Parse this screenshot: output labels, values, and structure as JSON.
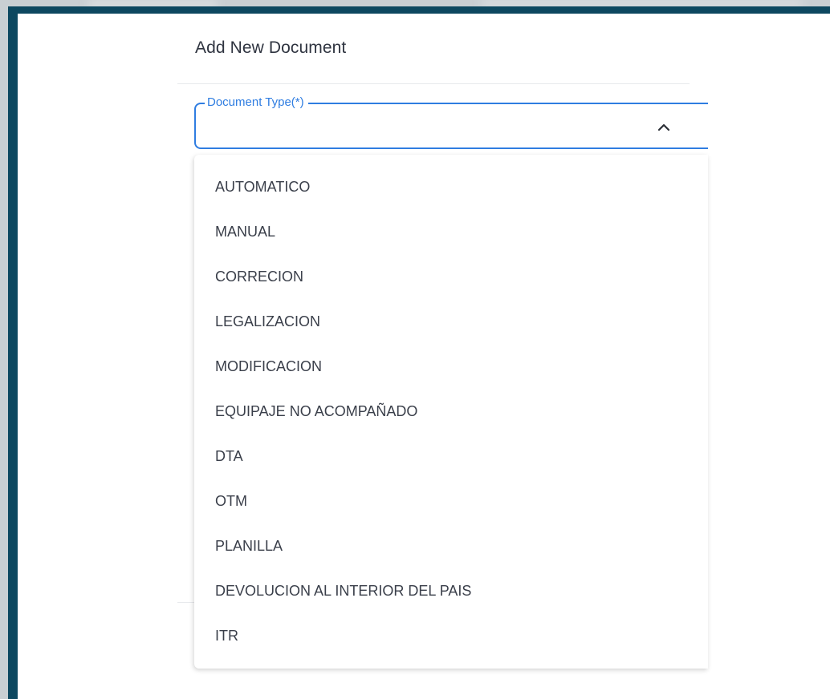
{
  "dialog": {
    "title": "Add New Document"
  },
  "field": {
    "label": "Document Type(*)",
    "value": "",
    "expanded": true,
    "toggle_icon": "chevron-up-icon"
  },
  "options": [
    "AUTOMATICO",
    "MANUAL",
    "CORRECION",
    "LEGALIZACION",
    "MODIFICACION",
    "EQUIPAJE NO ACOMPAÑADO",
    "DTA",
    "OTM",
    "PLANILLA",
    "DEVOLUCION AL INTERIOR DEL PAIS",
    "ITR"
  ],
  "colors": {
    "frame": "#0d4860",
    "accent": "#2f7de1",
    "text": "#3a3f4a",
    "title": "#2f3440"
  }
}
